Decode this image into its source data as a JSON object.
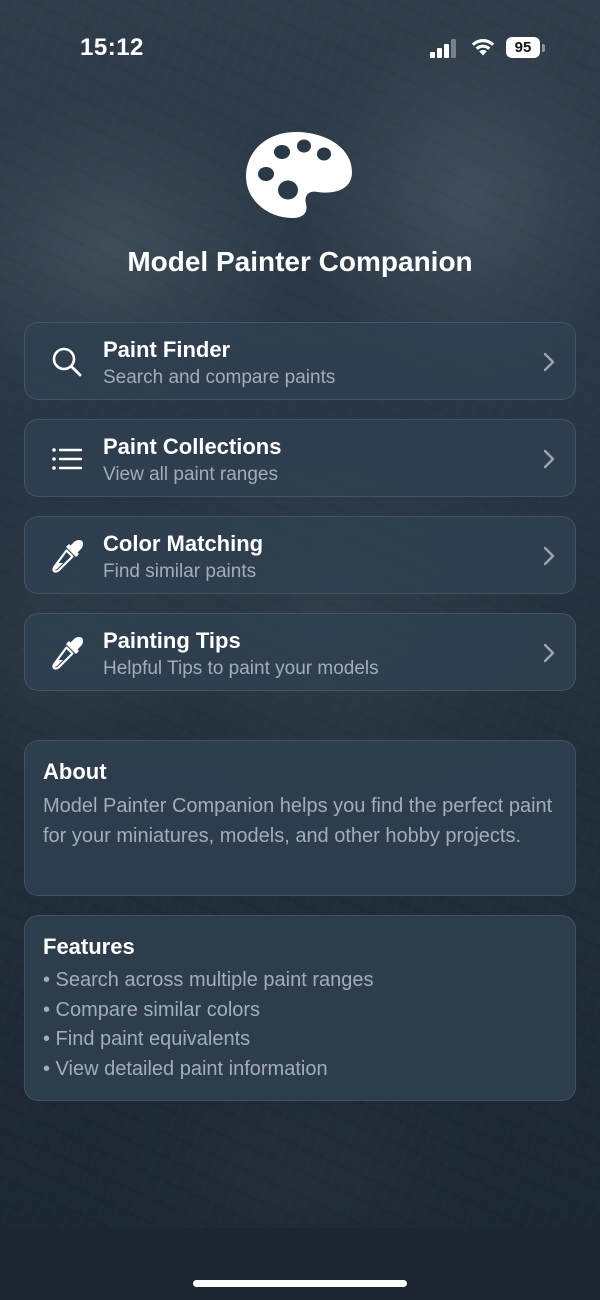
{
  "status_bar": {
    "time": "15:12",
    "battery": "95",
    "icons": [
      "signal-icon",
      "wifi-icon",
      "battery-icon"
    ]
  },
  "app": {
    "logo_icon": "palette-icon",
    "title": "Model Painter Companion"
  },
  "menu": {
    "items": [
      {
        "label": "Paint Finder",
        "subtitle": "Search and compare paints",
        "icon": "search-icon"
      },
      {
        "label": "Paint Collections",
        "subtitle": "View all paint ranges",
        "icon": "list-icon"
      },
      {
        "label": "Color Matching",
        "subtitle": "Find similar paints",
        "icon": "eyedropper-icon"
      },
      {
        "label": "Painting Tips",
        "subtitle": "Helpful Tips to paint your models",
        "icon": "eyedropper-icon"
      }
    ]
  },
  "about": {
    "title": "About",
    "body": "Model Painter Companion helps you find the perfect paint for your miniatures, models, and other hobby projects."
  },
  "features": {
    "title": "Features",
    "items": [
      "• Search across multiple paint ranges",
      "• Compare similar colors",
      "• Find paint equivalents",
      "• View detailed paint information"
    ]
  },
  "colors": {
    "background": "#2a3745",
    "card": "#304050",
    "text_primary": "#ffffff",
    "text_secondary": "#a3adb8"
  }
}
